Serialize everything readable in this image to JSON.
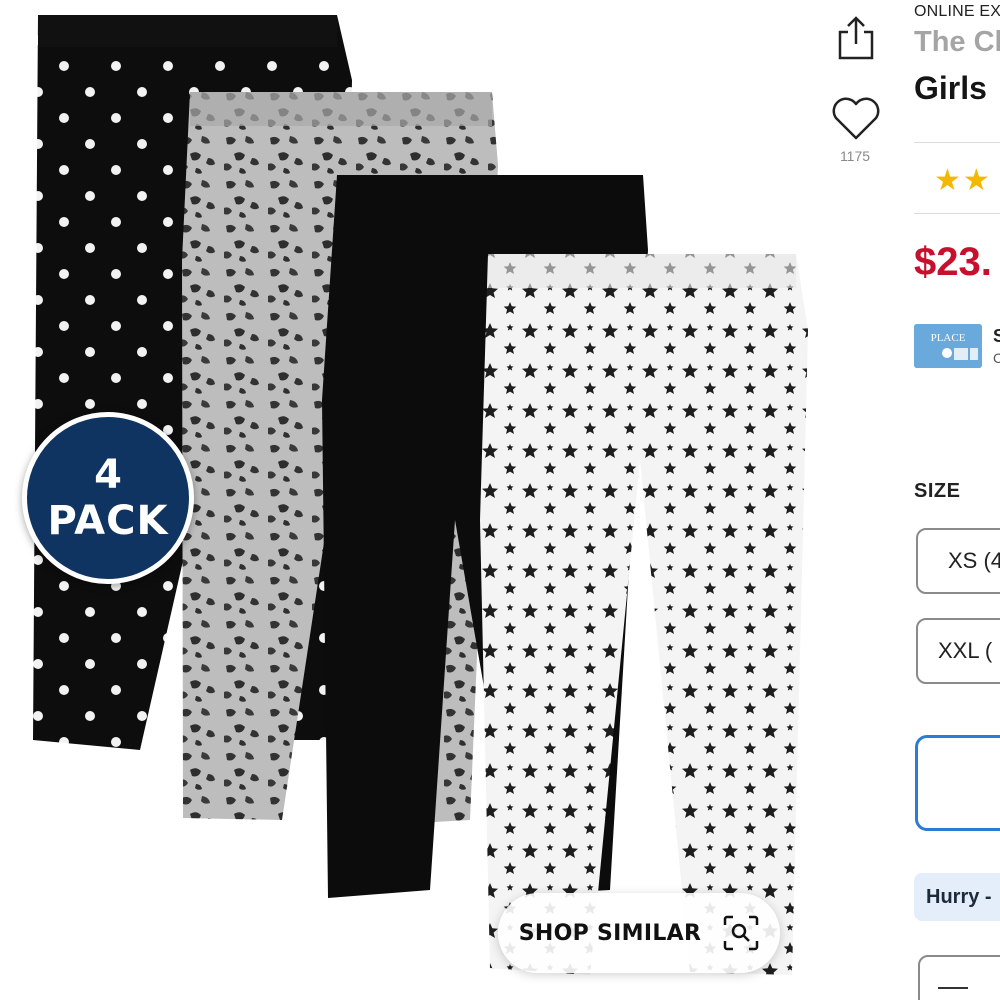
{
  "product_image": {
    "alt_badge": {
      "number": "4",
      "word": "PACK"
    },
    "shop_similar_label": "SHOP SIMILAR",
    "shop_similar_icon": "visual-search-icon"
  },
  "actions": {
    "share_icon": "share-icon",
    "favorite_icon": "heart-icon",
    "favorite_count": "1175"
  },
  "info": {
    "badge_text": "ONLINE EX",
    "brand": "The Ch",
    "title": "Girls",
    "rating_stars": 2,
    "price": "$23.",
    "card_logo_text": "PLACE",
    "card_text_1": "S",
    "card_text_2": "C",
    "size_heading": "SIZE",
    "sizes": [
      "XS (4",
      "XXL ("
    ],
    "hurry_text": "Hurry -"
  },
  "colors": {
    "badge_navy": "#0f3461",
    "price_red": "#c8102e",
    "star_gold": "#f5b800",
    "focus_blue": "#2c7bd6",
    "hurry_bg": "#e3eefa"
  }
}
